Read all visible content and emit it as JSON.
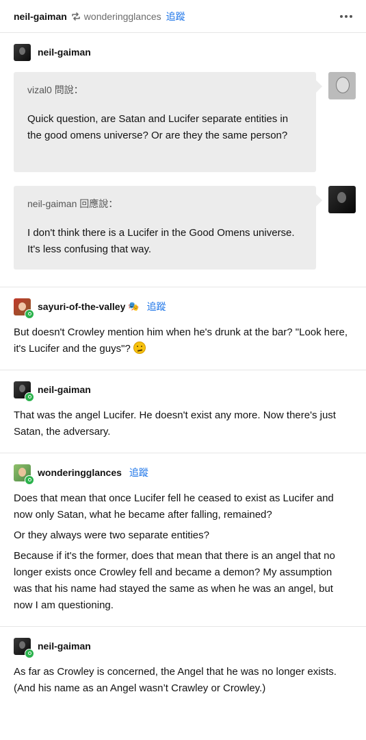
{
  "header": {
    "author": "neil-gaiman",
    "reblogged_from": "wonderingglances",
    "follow_label": "追蹤",
    "reblog_icon": "reblog-icon",
    "more_icon": "more-icon"
  },
  "thread": {
    "top_author": "neil-gaiman",
    "ask": {
      "asker": "vizal0",
      "asker_suffix": "問說：",
      "question": "Quick question, are Satan and Lucifer separate entities in the good omens universe? Or are they the same person?"
    },
    "answer": {
      "answerer": "neil-gaiman",
      "answerer_suffix": "回應說：",
      "text": "I don't think there is a Lucifer in the Good Omens universe. It's less confusing that way."
    }
  },
  "posts": [
    {
      "author": "sayuri-of-the-valley",
      "follow_label": "追蹤",
      "sticker": "🎭",
      "text": "But doesn't Crowley mention him when he's drunk at the bar? \"Look here, it's Lucifer and the guys\"?"
    },
    {
      "author": "neil-gaiman",
      "text": "That was the angel Lucifer.  He doesn't exist any more. Now there's just Satan, the adversary."
    },
    {
      "author": "wonderingglances",
      "follow_label": "追蹤",
      "paragraphs": [
        "Does that mean that once Lucifer fell he ceased to exist as Lucifer and now only Satan, what he became after falling, remained?",
        "Or they always were two separate entities?",
        "Because if it's the former, does that mean that there is an angel that no longer exists once Crowley fell and became a demon? My assumption was that his name had stayed the same as when he was an angel, but now I am questioning."
      ]
    },
    {
      "author": "neil-gaiman",
      "text": "As far as Crowley is concerned, the Angel that he was no longer exists. (And his name as an Angel wasn’t Crawley or Crowley.)"
    }
  ],
  "colors": {
    "follow_blue": "#1a73e8",
    "bubble_gray": "#ececec",
    "badge_green": "#2bb24c"
  }
}
